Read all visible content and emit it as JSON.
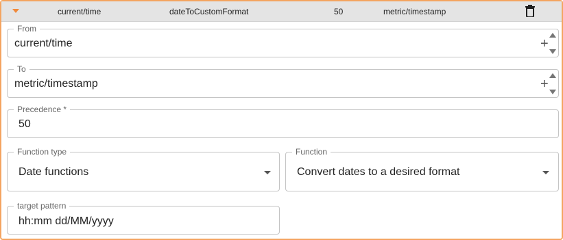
{
  "header": {
    "from": "current/time",
    "function_code": "dateToCustomFormat",
    "precedence": "50",
    "to": "metric/timestamp",
    "accent_color": "#f08a3c"
  },
  "from_field": {
    "label": "From",
    "value": "current/time"
  },
  "to_field": {
    "label": "To",
    "value": "metric/timestamp"
  },
  "precedence_field": {
    "label": "Precedence *",
    "value": "50"
  },
  "function_type_field": {
    "label": "Function type",
    "value": "Date functions"
  },
  "function_field": {
    "label": "Function",
    "value": "Convert dates to a desired format"
  },
  "target_pattern_field": {
    "label": "target pattern",
    "value": "hh:mm dd/MM/yyyy"
  },
  "icons": {
    "expand": "caret-down-icon",
    "delete": "trash-icon",
    "add": "plus-icon",
    "stepper_up": "arrow-up-icon",
    "stepper_down": "arrow-down-icon",
    "dropdown": "dropdown-arrow-icon"
  }
}
